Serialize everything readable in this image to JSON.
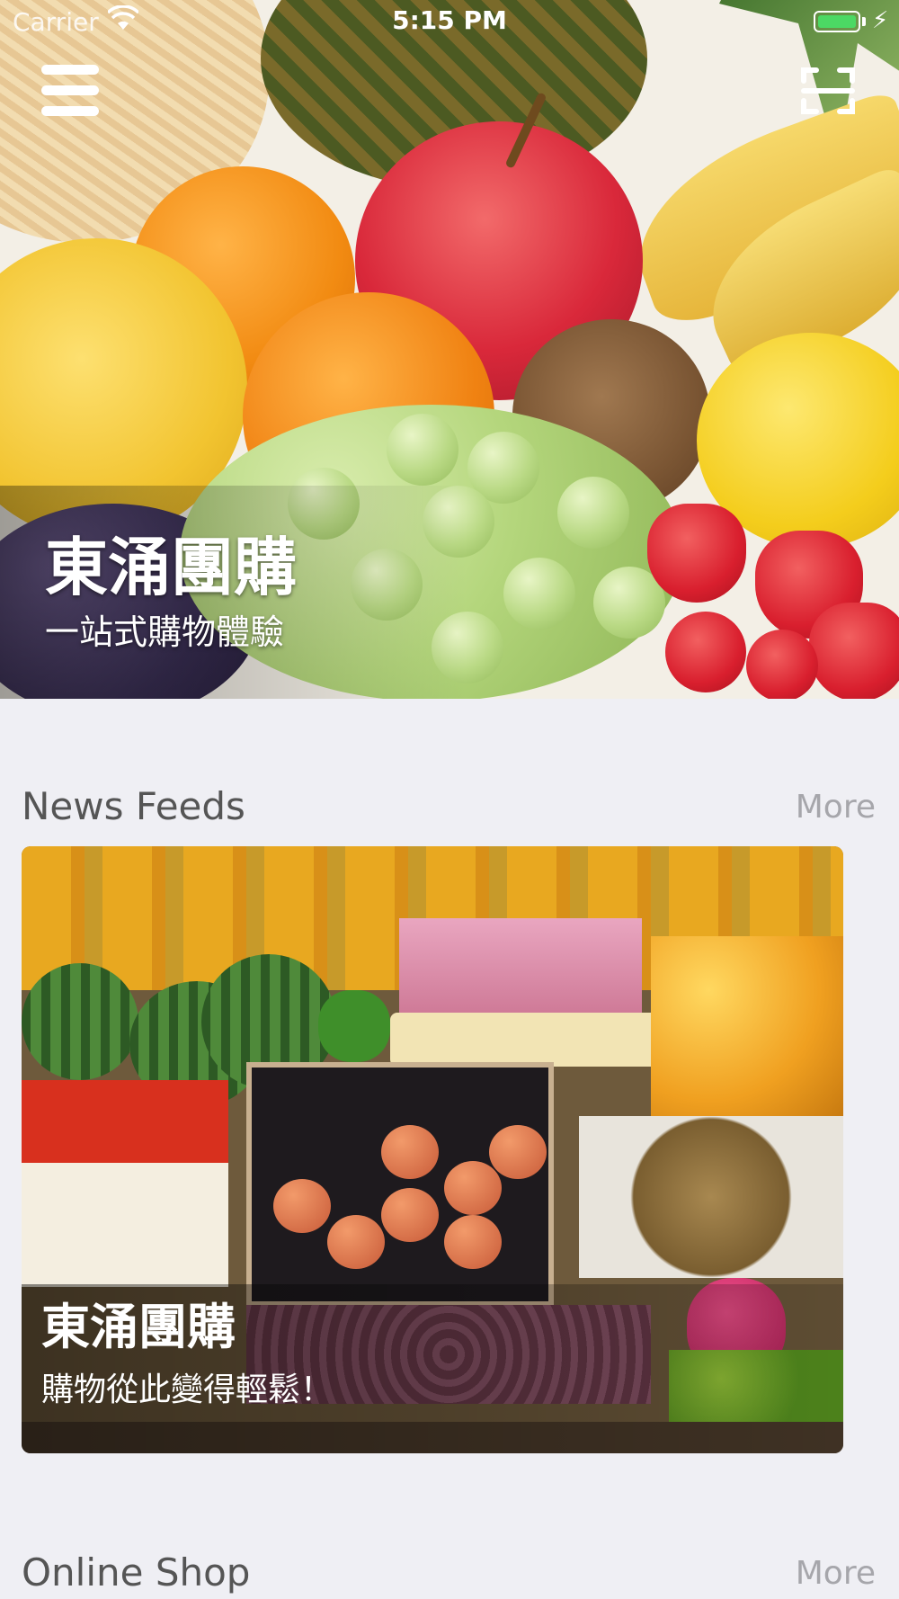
{
  "status_bar": {
    "carrier": "Carrier",
    "time": "5:15 PM",
    "battery_color": "#4cd964"
  },
  "nav": {
    "menu_icon": "hamburger-menu-icon",
    "scan_icon": "scan-qr-icon"
  },
  "hero": {
    "title": "東涌團購",
    "subtitle": "一站式購物體驗"
  },
  "news_feeds": {
    "title": "News Feeds",
    "more_label": "More",
    "card": {
      "title": "東涌團購",
      "subtitle": "購物從此變得輕鬆！"
    }
  },
  "online_shop": {
    "title": "Online Shop",
    "more_label": "More"
  },
  "colors": {
    "background": "#efeff4",
    "section_title": "#555555",
    "more_link": "#a6a6ab"
  }
}
